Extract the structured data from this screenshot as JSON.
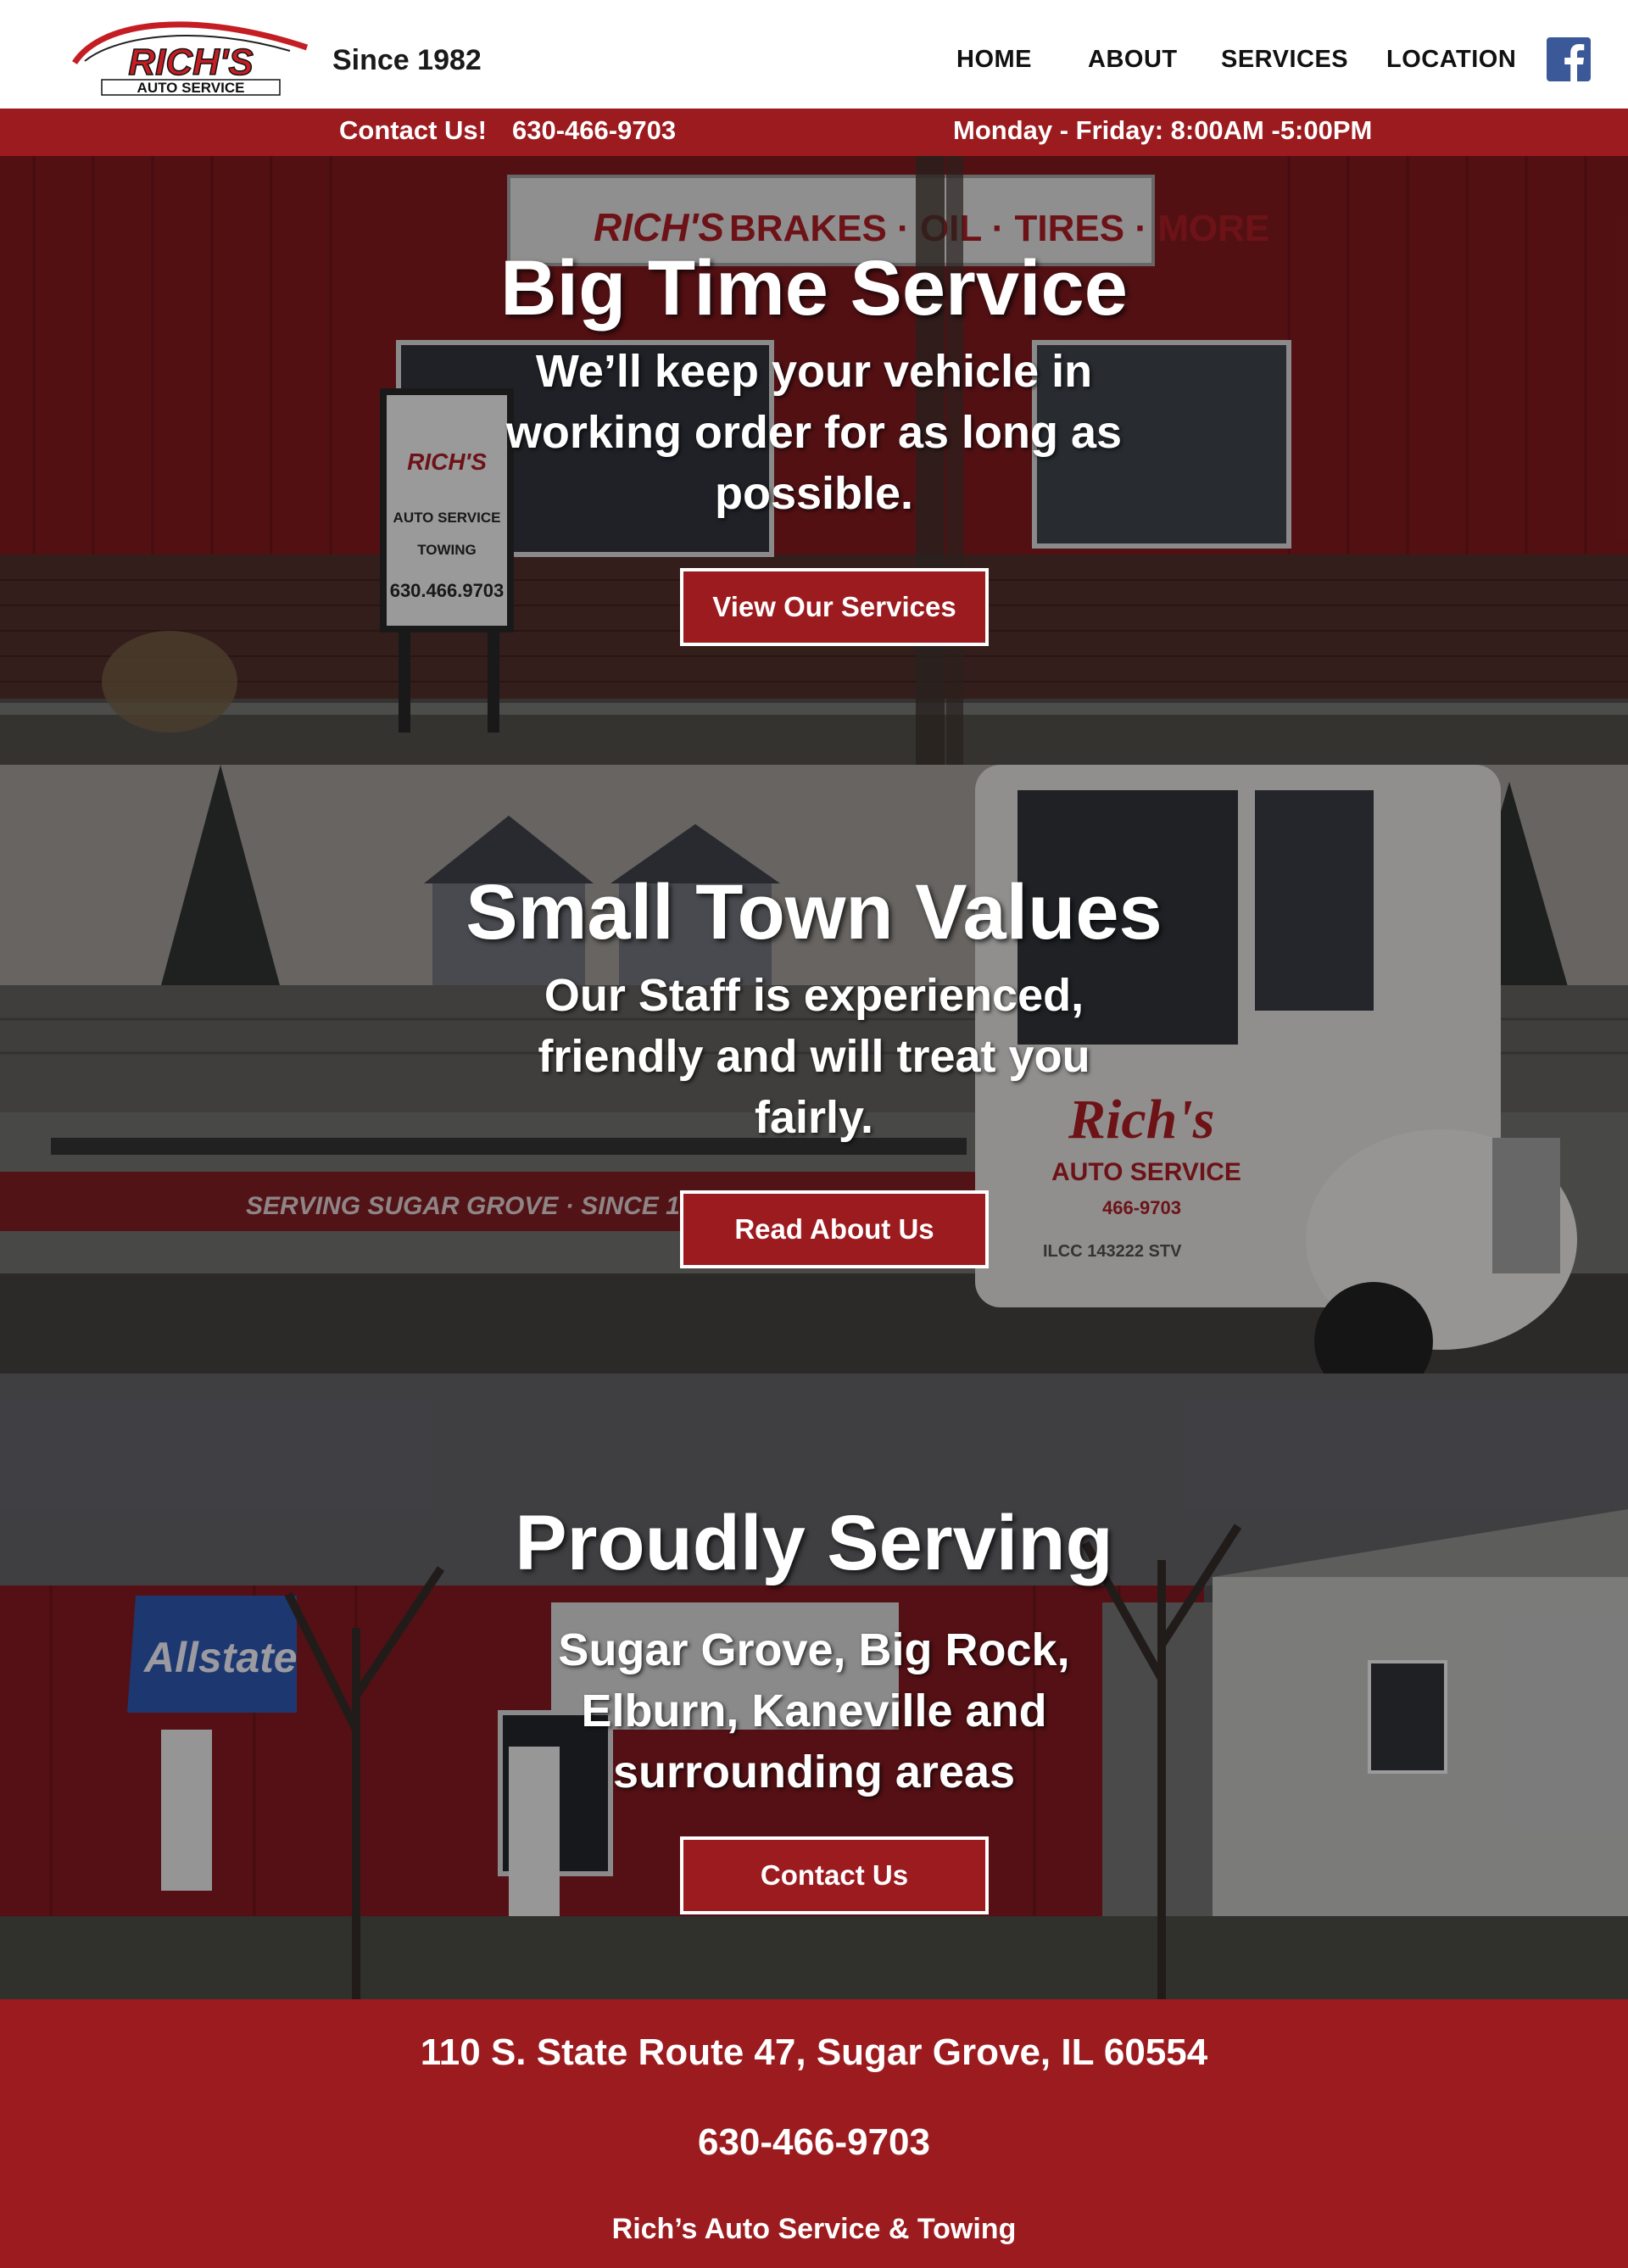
{
  "header": {
    "logo_text": "RICH'S",
    "logo_subtext": "AUTO SERVICE",
    "since": "Since 1982",
    "nav": [
      "HOME",
      "ABOUT",
      "SERVICES",
      "LOCATION"
    ],
    "facebook_icon": "facebook-icon"
  },
  "infobar": {
    "contact_label": "Contact Us!",
    "phone": "630-466-9703",
    "hours": "Monday - Friday: 8:00AM -5:00PM"
  },
  "sections": [
    {
      "title": "Big Time Service",
      "subtitle": "We’ll keep your vehicle in working order for as long as possible.",
      "button": "View Our Services"
    },
    {
      "title": "Small Town Values",
      "subtitle": "Our Staff is experienced, friendly and will treat you fairly.",
      "button": "Read About Us"
    },
    {
      "title": "Proudly Serving",
      "subtitle": "Sugar Grove, Big Rock, Elburn, Kaneville and surrounding areas",
      "button": "Contact Us"
    }
  ],
  "scene_signs": {
    "sign_brand": "RICH'S",
    "sign_tagline": "BRAKES · OIL · TIRES · MORE",
    "post_sign_lines": [
      "AUTO SERVICE",
      "TOWING",
      "630.466.9703"
    ],
    "truck_bed_text": "SERVING SUGAR GROVE · SINCE 1984",
    "truck_door_lines": [
      "Rich's",
      "AUTO SERVICE",
      "466-9703",
      "ILCC 143222 STV"
    ],
    "awning_text": "Allstate"
  },
  "footer": {
    "address": "110 S. State Route 47, Sugar Grove, IL 60554",
    "phone": "630-466-9703",
    "company": "Rich’s Auto Service & Towing"
  },
  "colors": {
    "brand_red": "#9c1b1f",
    "white": "#ffffff",
    "dark_text": "#111111"
  }
}
